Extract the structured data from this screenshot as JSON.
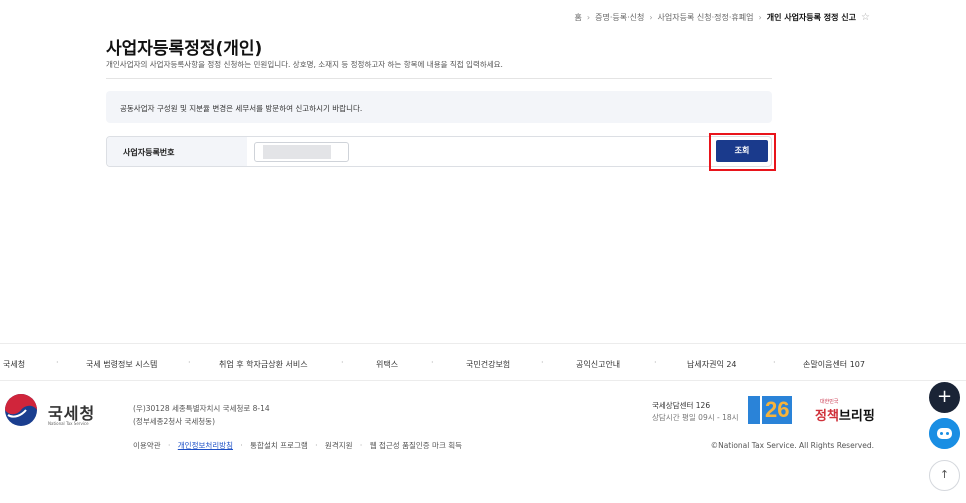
{
  "breadcrumb": {
    "items": [
      "홈",
      "증명·등록·신청",
      "사업자등록 신청·정정·휴폐업",
      "개인 사업자등록 정정 신고"
    ]
  },
  "page": {
    "title": "사업자등록정정(개인)",
    "description": "개인사업자의 사업자등록사항을 정정 신청하는 민원입니다. 상호명, 소재지 등 정정하고자 하는 항목에 내용을 직접 입력하세요."
  },
  "notice": "공동사업자 구성원 및 지분율 변경은 세무서를 방문하여 신고하시기 바랍니다.",
  "form": {
    "label": "사업자등록번호",
    "search_label": "조회"
  },
  "footer_links": [
    "국세청",
    "국세 법령정보 시스템",
    "취업 후 학자금상환 서비스",
    "위택스",
    "국민건강보험",
    "공익신고안내",
    "납세자권익 24",
    "손말이음센터 107"
  ],
  "org": {
    "name": "국세청",
    "name_en": "National Tax Service",
    "address1": "(우)30128 세종특별자치시 국세청로 8-14",
    "address2": "(정부세종2청사 국세청동)"
  },
  "policy_links": [
    "이용약관",
    "개인정보처리방침",
    "통합설치 프로그램",
    "원격지원",
    "웹 접근성 품질인증 마크 획득"
  ],
  "consult": {
    "center": "국세상담센터 126",
    "hours": "상담시간 평일 09시 - 18시",
    "number_mark": "26"
  },
  "gov_brand": {
    "small": "대한민국",
    "main_a": "정책",
    "main_b": "브리핑"
  },
  "copyright": "©National Tax Service. All Rights Reserved.",
  "colors": {
    "primary": "#1a3a8c",
    "highlight": "#e8141b",
    "link": "#1c4fc6"
  },
  "icons": {
    "star": "☆",
    "plus": "+",
    "top": "↑"
  }
}
